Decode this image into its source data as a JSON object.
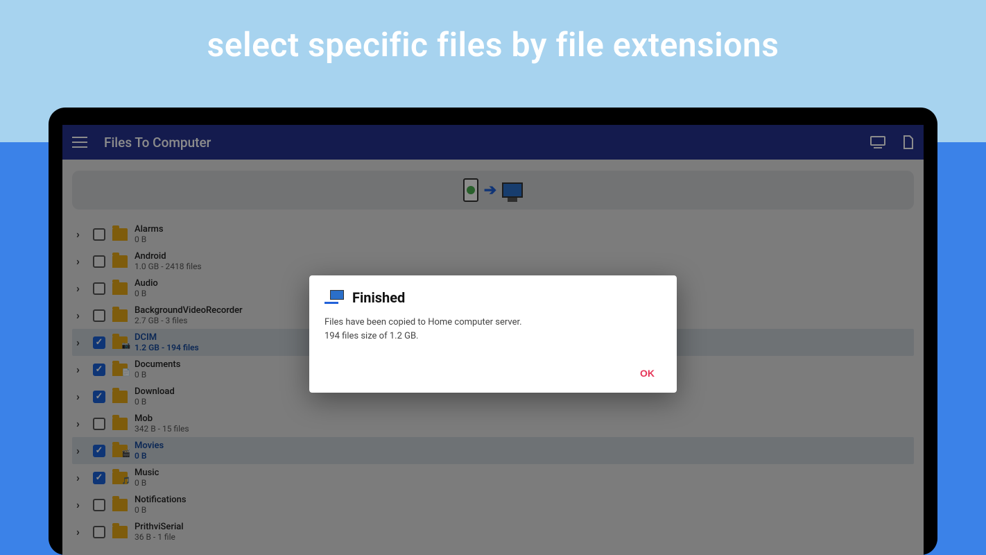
{
  "promo": {
    "headline": "select specific files by file extensions"
  },
  "appbar": {
    "title": "Files To Computer"
  },
  "folders": [
    {
      "name": "Alarms",
      "sub": "0 B",
      "checked": false,
      "overlay": ""
    },
    {
      "name": "Android",
      "sub": "1.0 GB - 2418 files",
      "checked": false,
      "overlay": ""
    },
    {
      "name": "Audio",
      "sub": "0 B",
      "checked": false,
      "overlay": ""
    },
    {
      "name": "BackgroundVideoRecorder",
      "sub": "2.7 GB - 3 files",
      "checked": false,
      "overlay": ""
    },
    {
      "name": "DCIM",
      "sub": "1.2 GB - 194 files",
      "checked": true,
      "overlay": "📷",
      "selected": true
    },
    {
      "name": "Documents",
      "sub": "0 B",
      "checked": true,
      "overlay": "📄"
    },
    {
      "name": "Download",
      "sub": "0 B",
      "checked": true,
      "overlay": ""
    },
    {
      "name": "Mob",
      "sub": "342 B - 15 files",
      "checked": false,
      "overlay": ""
    },
    {
      "name": "Movies",
      "sub": "0 B",
      "checked": true,
      "overlay": "🎬",
      "selected": true
    },
    {
      "name": "Music",
      "sub": "0 B",
      "checked": true,
      "overlay": "🎵"
    },
    {
      "name": "Notifications",
      "sub": "0 B",
      "checked": false,
      "overlay": ""
    },
    {
      "name": "PrithviSerial",
      "sub": "36 B - 1 file",
      "checked": false,
      "overlay": ""
    }
  ],
  "dialog": {
    "title": "Finished",
    "line1": "Files have been copied to Home computer server.",
    "line2": "194 files size of 1.2 GB.",
    "ok": "OK"
  }
}
